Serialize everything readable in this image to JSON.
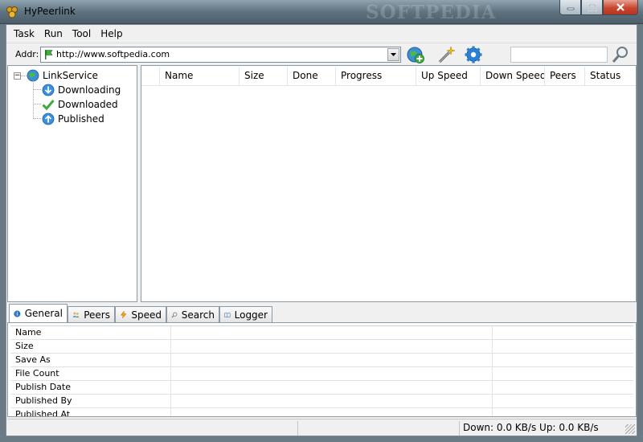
{
  "window": {
    "title": "HyPeerlink",
    "watermark": "SOFTPEDIA"
  },
  "menu": [
    "Task",
    "Run",
    "Tool",
    "Help"
  ],
  "toolbar": {
    "addr_label": "Addr:",
    "addr_value": "http://www.softpedia.com",
    "search_value": "",
    "icons": [
      "add-link-icon",
      "wand-icon",
      "settings-gear-icon"
    ]
  },
  "tree": {
    "root": "LinkService",
    "children": [
      "Downloading",
      "Downloaded",
      "Published"
    ]
  },
  "list": {
    "columns": [
      "Name",
      "Size",
      "Done",
      "Progress",
      "Up Speed",
      "Down Speed",
      "Peers",
      "Status"
    ],
    "rows": []
  },
  "tabs": [
    "General",
    "Peers",
    "Speed",
    "Search",
    "Logger"
  ],
  "details": {
    "fields": [
      "Name",
      "Size",
      "Save As",
      "File Count",
      "Publish Date",
      "Published By",
      "Published At"
    ]
  },
  "status": {
    "down_label": "Down:",
    "down_value": "0.0",
    "down_unit": "KB/s",
    "up_label": "Up:",
    "up_value": "0.0",
    "up_unit": "KB/s"
  }
}
